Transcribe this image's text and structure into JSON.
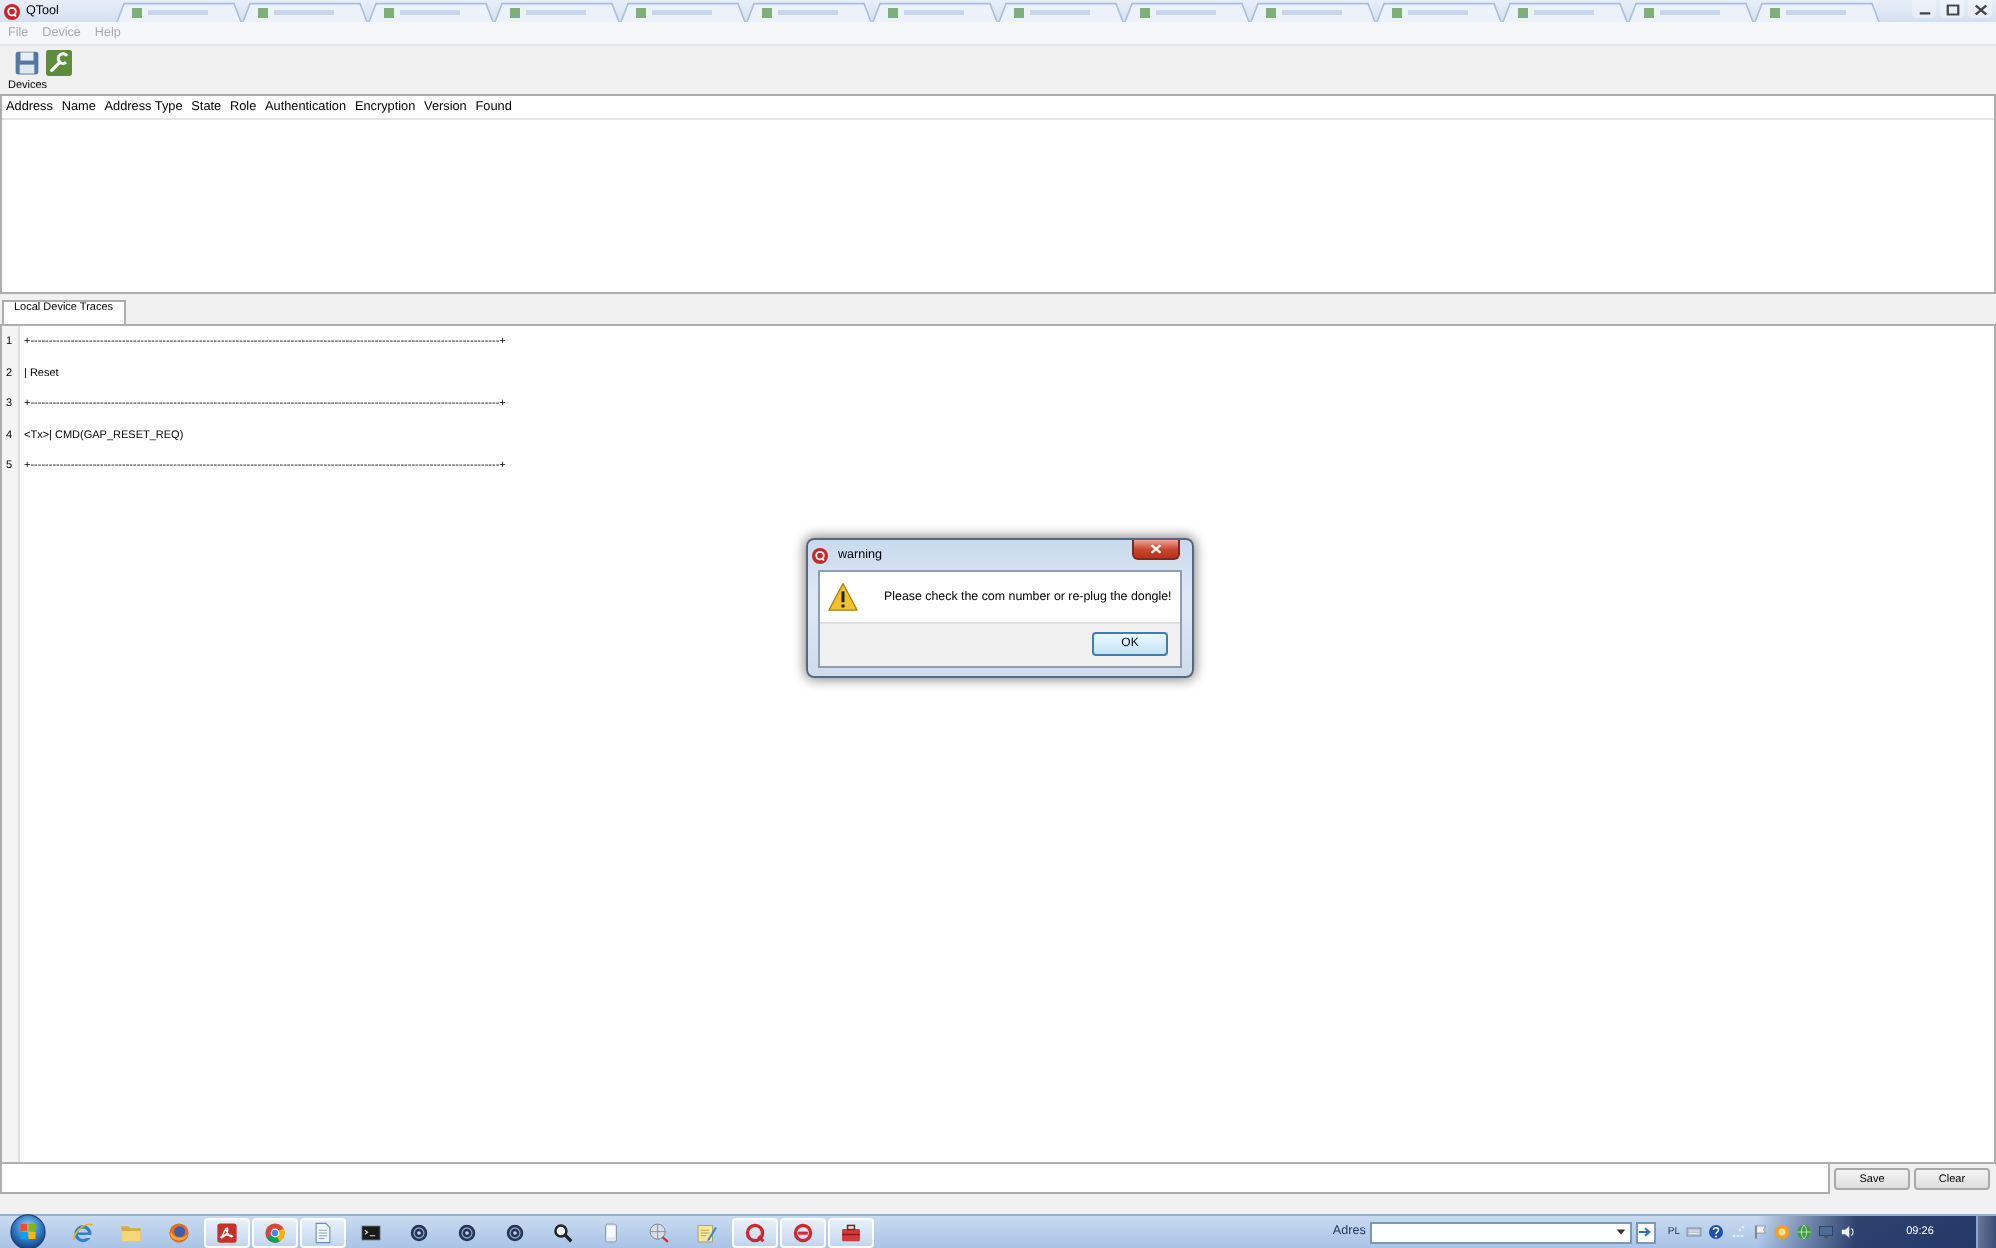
{
  "window": {
    "title": "QTool"
  },
  "menu": [
    {
      "label": "File",
      "disabled": true
    },
    {
      "label": "Device",
      "disabled": true
    },
    {
      "label": "Help",
      "disabled": true
    }
  ],
  "devices": {
    "title": "Devices",
    "columns": [
      "Address",
      "Name",
      "Address Type",
      "State",
      "Role",
      "Authentication",
      "Encryption",
      "Version",
      "Found"
    ]
  },
  "traces": {
    "tabs": [
      {
        "label": "Local Device Traces",
        "selected": true
      }
    ],
    "lines": [
      {
        "number": "1",
        "text": "+--------------------------------------------------------------------------------------------------------------------------------+"
      },
      {
        "number": "2",
        "text": "| Reset"
      },
      {
        "number": "3",
        "text": "+--------------------------------------------------------------------------------------------------------------------------------+"
      },
      {
        "number": "4",
        "text": "<Tx>| CMD(GAP_RESET_REQ)"
      },
      {
        "number": "5",
        "text": "+--------------------------------------------------------------------------------------------------------------------------------+"
      }
    ],
    "buttons": [
      "Save",
      "Clear"
    ]
  },
  "dialog": {
    "title": "warning",
    "message": "Please check the com number or re-plug the dongle!",
    "buttons": [
      "OK"
    ]
  },
  "taskbar": {
    "apps": [
      {
        "kind": "ebrowser",
        "running": false
      },
      {
        "kind": "folder",
        "running": false
      },
      {
        "kind": "globe",
        "running": false
      },
      {
        "kind": "pdf",
        "running": true
      },
      {
        "kind": "wheel",
        "running": true
      },
      {
        "kind": "page",
        "running": true
      },
      {
        "kind": "console",
        "running": false
      },
      {
        "kind": "disc",
        "running": false
      },
      {
        "kind": "disc",
        "running": false
      },
      {
        "kind": "disc",
        "running": false
      },
      {
        "kind": "search",
        "running": false
      },
      {
        "kind": "phone",
        "running": false
      },
      {
        "kind": "network",
        "running": false
      },
      {
        "kind": "notepad",
        "running": false
      },
      {
        "kind": "ring",
        "running": true
      },
      {
        "kind": "ringbar",
        "running": true
      },
      {
        "kind": "toolbox",
        "running": true
      }
    ],
    "address_label": "Adres",
    "language": "PL",
    "clock": "09:26"
  }
}
